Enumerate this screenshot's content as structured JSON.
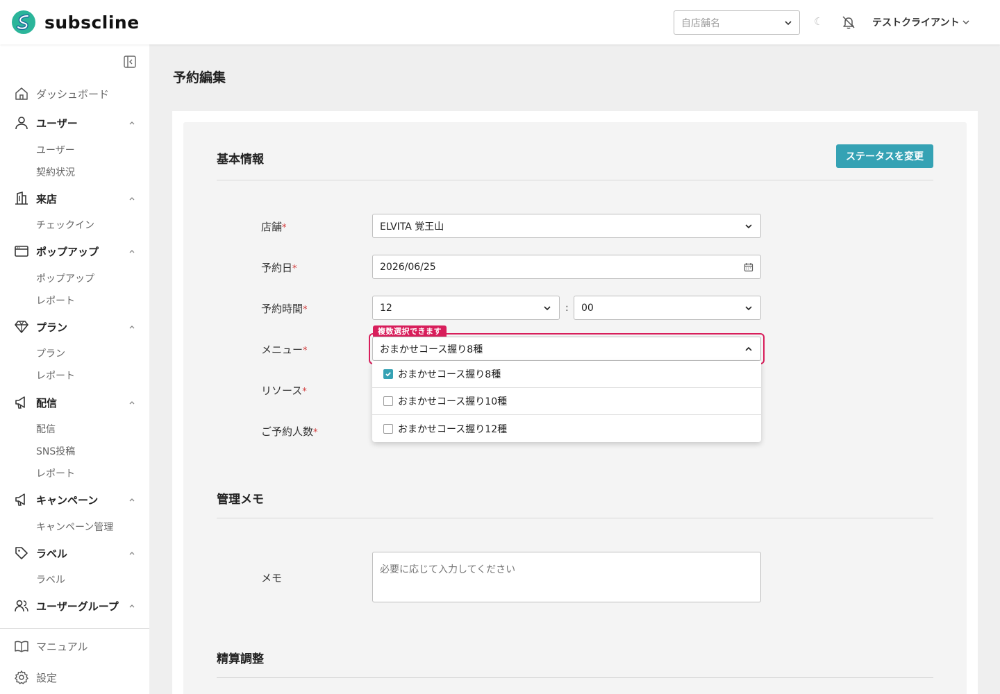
{
  "header": {
    "logo_text": "subscline",
    "store_select_placeholder": "自店舗名",
    "client_name": "テストクライアント"
  },
  "sidebar": {
    "dashboard": "ダッシュボード",
    "user": {
      "label": "ユーザー",
      "items": [
        "ユーザー",
        "契約状況"
      ]
    },
    "visit": {
      "label": "来店",
      "items": [
        "チェックイン"
      ]
    },
    "popup": {
      "label": "ポップアップ",
      "items": [
        "ポップアップ",
        "レポート"
      ]
    },
    "plan": {
      "label": "プラン",
      "items": [
        "プラン",
        "レポート"
      ]
    },
    "delivery": {
      "label": "配信",
      "items": [
        "配信",
        "SNS投稿",
        "レポート"
      ]
    },
    "campaign": {
      "label": "キャンペーン",
      "items": [
        "キャンペーン管理"
      ]
    },
    "label": {
      "label": "ラベル",
      "items": [
        "ラベル"
      ]
    },
    "usergroup": {
      "label": "ユーザーグループ"
    },
    "manual": "マニュアル",
    "settings": "設定"
  },
  "page": {
    "title": "予約編集",
    "section_basic": "基本情報",
    "status_button": "ステータスを変更",
    "section_memo": "管理メモ",
    "section_settlement": "精算調整"
  },
  "form": {
    "store_label": "店舗",
    "store_value": "ELVITA 覚王山",
    "date_label": "予約日",
    "date_value": "2026/06/25",
    "time_label": "予約時間",
    "hour_value": "12",
    "minute_value": "00",
    "colon": ":",
    "menu_label": "メニュー",
    "menu_badge": "複数選択できます",
    "menu_value": "おまかせコース握り8種",
    "menu_options": [
      {
        "label": "おまかせコース握り8種",
        "checked": true
      },
      {
        "label": "おまかせコース握り10種",
        "checked": false
      },
      {
        "label": "おまかせコース握り12種",
        "checked": false
      }
    ],
    "resource_label": "リソース",
    "people_label": "ご予約人数",
    "required_mark": "*",
    "memo_label": "メモ",
    "memo_placeholder": "必要に応じて入力してください"
  },
  "colors": {
    "accent": "#35a2b4",
    "highlight": "#d81e5b",
    "required": "#d23c3c"
  }
}
